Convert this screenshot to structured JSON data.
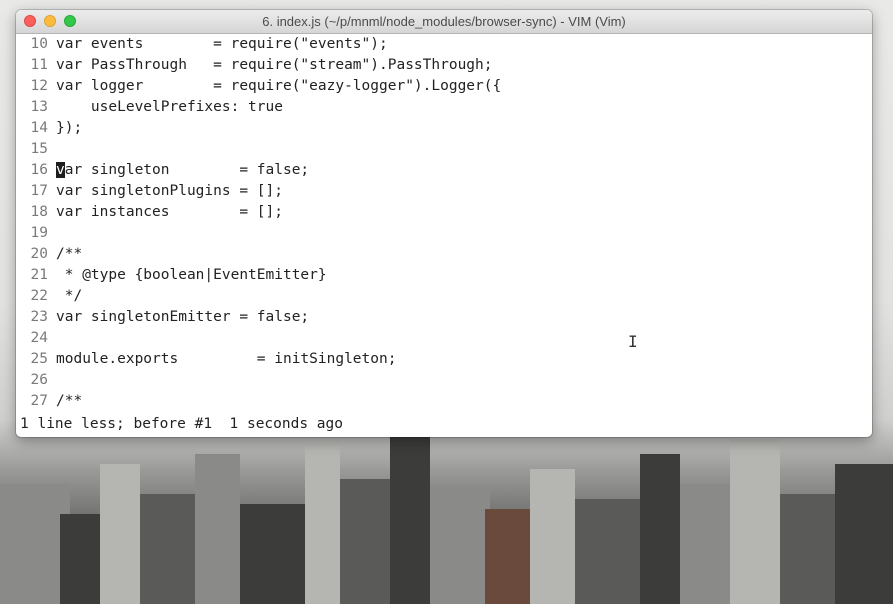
{
  "window": {
    "title": "6. index.js (~/p/mnml/node_modules/browser-sync) - VIM (Vim)"
  },
  "lines": [
    {
      "num": "10",
      "text": "var events        = require(\"events\");"
    },
    {
      "num": "11",
      "text": "var PassThrough   = require(\"stream\").PassThrough;"
    },
    {
      "num": "12",
      "text": "var logger        = require(\"eazy-logger\").Logger({"
    },
    {
      "num": "13",
      "text": "    useLevelPrefixes: true"
    },
    {
      "num": "14",
      "text": "});"
    },
    {
      "num": "15",
      "text": ""
    },
    {
      "num": "16",
      "cursor_char": "v",
      "text": "ar singleton        = false;"
    },
    {
      "num": "17",
      "text": "var singletonPlugins = [];"
    },
    {
      "num": "18",
      "text": "var instances        = [];"
    },
    {
      "num": "19",
      "text": ""
    },
    {
      "num": "20",
      "text": "/**"
    },
    {
      "num": "21",
      "text": " * @type {boolean|EventEmitter}"
    },
    {
      "num": "22",
      "text": " */"
    },
    {
      "num": "23",
      "text": "var singletonEmitter = false;"
    },
    {
      "num": "24",
      "text": ""
    },
    {
      "num": "25",
      "text": "module.exports         = initSingleton;"
    },
    {
      "num": "26",
      "text": ""
    },
    {
      "num": "27",
      "text": "/**"
    }
  ],
  "status": {
    "message": "1 line less; before #1  1 seconds ago"
  },
  "mouse": {
    "cursor_glyph": "I"
  }
}
